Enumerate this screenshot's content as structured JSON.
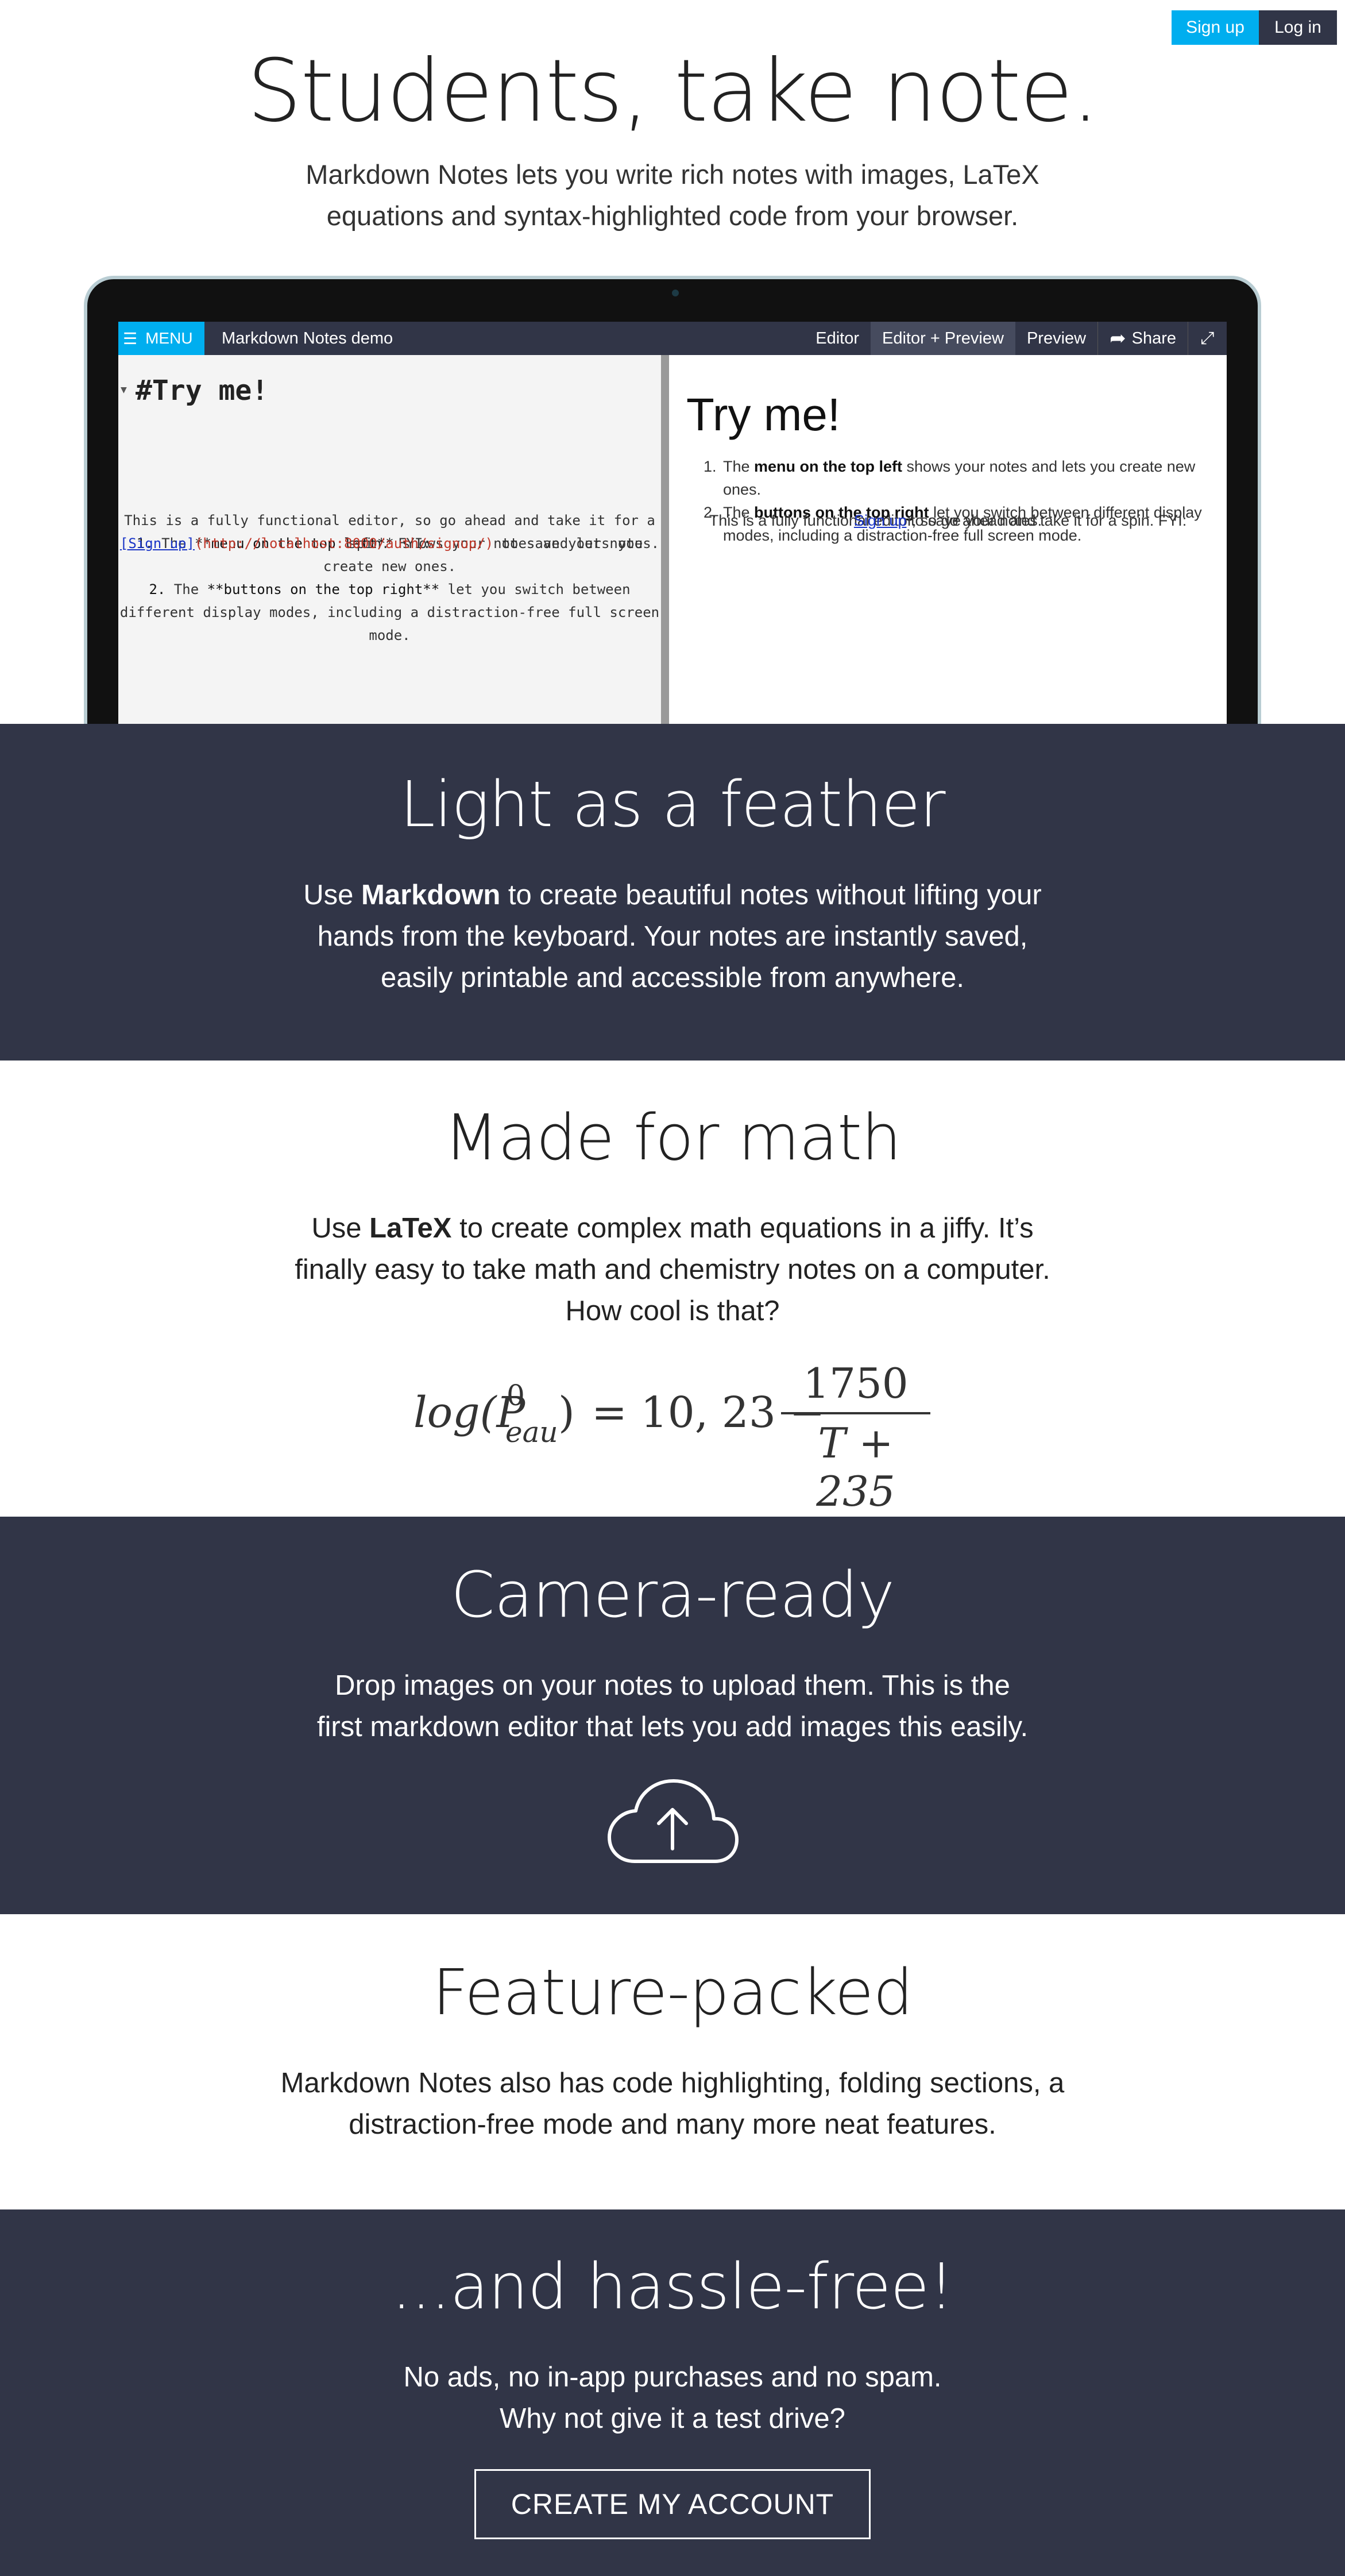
{
  "auth": {
    "signup_label": "Sign up",
    "login_label": "Log in"
  },
  "hero": {
    "title": "Students, take note.",
    "subtitle_line1": "Markdown Notes lets you write rich notes with images, LaTeX",
    "subtitle_line2": "equations and syntax-highlighted code from your browser."
  },
  "demo": {
    "menu_label": "MENU",
    "doc_title": "Markdown Notes demo",
    "modes": [
      "Editor",
      "Editor + Preview",
      "Preview"
    ],
    "active_mode": "Editor + Preview",
    "share_label": "Share",
    "editor": {
      "heading": "#Try me!",
      "intro": "This is a fully functional editor, so go ahead and take it for a spin. FYI:",
      "item1_num": "1.",
      "item1_pre": " The ",
      "item1_bold": "**menu on the top left**",
      "item1_post": " shows your notes and lets you create new ones.",
      "item2_num": "2.",
      "item2_pre": " The ",
      "item2_bold": "**buttons on the top right**",
      "item2_post": " let you switch between different display modes, including a distraction-free full screen mode.",
      "link_text": "[Sign up]",
      "link_url": "(http://localhost:8000/auth/signup/)",
      "link_post": " to save your notes."
    },
    "preview": {
      "heading": "Try me!",
      "intro": "This is a fully functional editor, so go ahead and take it for a spin. FYI:",
      "item1_pre": "The ",
      "item1_bold": "menu on the top left",
      "item1_post": " shows your notes and lets you create new ones.",
      "item2_pre": "The ",
      "item2_bold": "buttons on the top right",
      "item2_post": " let you switch between different display modes, including a distraction-free full screen mode.",
      "link_text": "Sign up",
      "link_post": " to save your notes."
    }
  },
  "feather": {
    "title": "Light as a feather",
    "text_pre": "Use ",
    "text_bold": "Markdown",
    "text_post": " to create beautiful notes without lifting your hands from the keyboard. Your notes are instantly saved, easily printable and accessible from anywhere."
  },
  "math": {
    "title": "Made for math",
    "text_pre": "Use ",
    "text_bold": "LaTeX",
    "text_post": " to create complex math equations in a jiffy. It’s finally easy to take math and chemistry notes on a computer. How cool is that?",
    "formula": {
      "lhs": "log(P",
      "sup": "0",
      "sub": "eau",
      "close": ")",
      "middle": "= 10, 23 −",
      "numerator": "1750",
      "denominator": "T + 235"
    }
  },
  "camera": {
    "title": "Camera-ready",
    "text": "Drop images on your notes to upload them. This is the first markdown editor that lets you add images this easily.",
    "icon": "cloud-upload-icon"
  },
  "features": {
    "title": "Feature-packed",
    "text": "Markdown Notes also has code highlighting, folding sections, a distraction-free mode and many more neat features."
  },
  "hassle": {
    "title": "...and hassle-free!",
    "line1": "No ads, no in-app purchases and no spam.",
    "line2": "Why not give it a test drive?",
    "cta_label": "CREATE MY ACCOUNT"
  },
  "colors": {
    "accent": "#00aeef",
    "dark": "#313547",
    "link": "#1a35c7",
    "url": "#c0392b"
  }
}
